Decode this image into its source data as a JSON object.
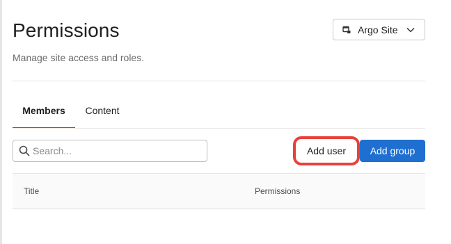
{
  "header": {
    "title": "Permissions",
    "subtitle": "Manage site access and roles.",
    "site_selector": {
      "label": "Argo Site",
      "icon": "site-icon"
    }
  },
  "tabs": [
    {
      "label": "Members",
      "active": true
    },
    {
      "label": "Content",
      "active": false
    }
  ],
  "toolbar": {
    "search_placeholder": "Search...",
    "search_value": "",
    "add_user_label": "Add user",
    "add_group_label": "Add group"
  },
  "table": {
    "columns": [
      "Title",
      "Permissions"
    ],
    "rows": []
  },
  "colors": {
    "accent": "#1f6fd1",
    "highlight": "#e8413c"
  }
}
